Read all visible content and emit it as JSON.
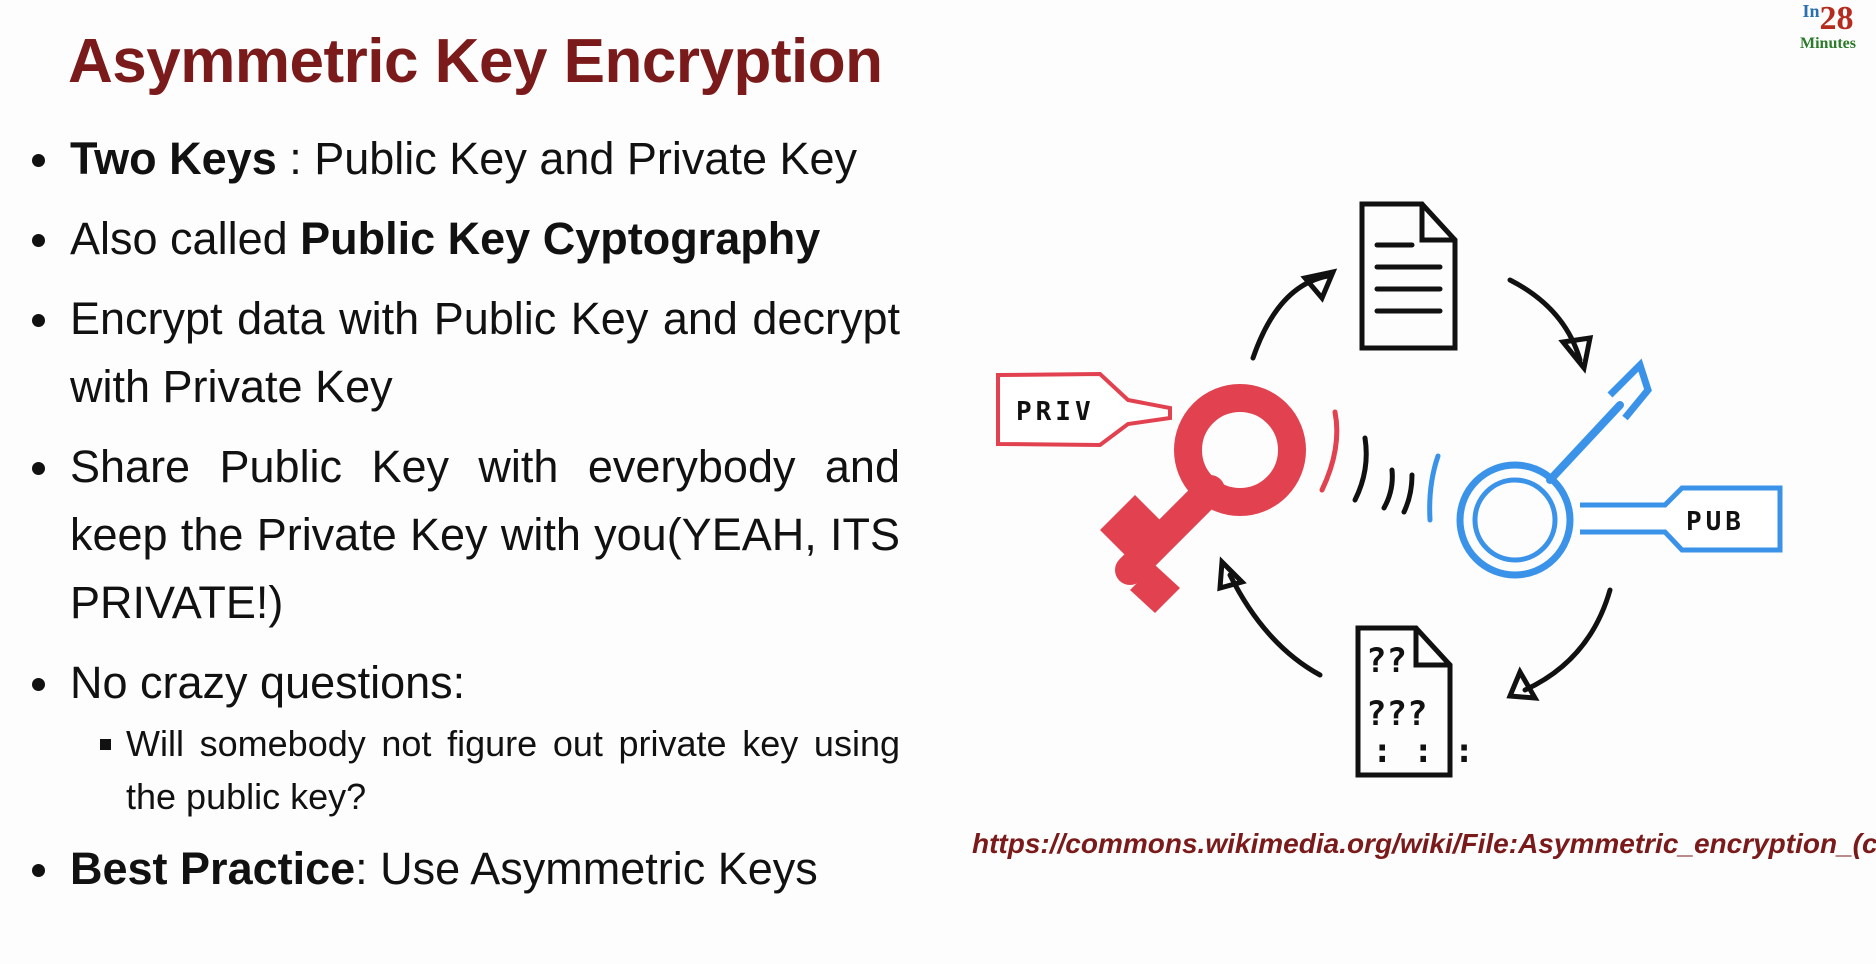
{
  "title": "Asymmetric Key Encryption",
  "logo": {
    "prefix": "In",
    "number": "28",
    "suffix": "Minutes"
  },
  "bullets": {
    "b1": {
      "bold": "Two Keys",
      "rest": " : Public Key and Private Key"
    },
    "b2": {
      "text": "Also called ",
      "bold": "Public Key Cyptography"
    },
    "b3": {
      "text": "Encrypt data with Public Key and decrypt with Private Key"
    },
    "b4": {
      "text": "Share Public Key with everybody and keep the Private Key with you(YEAH, ITS PRIVATE!)"
    },
    "b5": {
      "text": "No crazy questions:",
      "sub": "Will somebody not figure out private key using the public key?"
    },
    "b6": {
      "bold": "Best Practice",
      "rest": ": Use Asymmetric Keys"
    }
  },
  "diagram": {
    "priv_label": "PRIV",
    "pub_label": "PUB",
    "priv_color": "#e2424f",
    "pub_color": "#3a93e8"
  },
  "source_url": "https://commons.wikimedia.org/wiki/File:Asymmetric_encryption_(co"
}
